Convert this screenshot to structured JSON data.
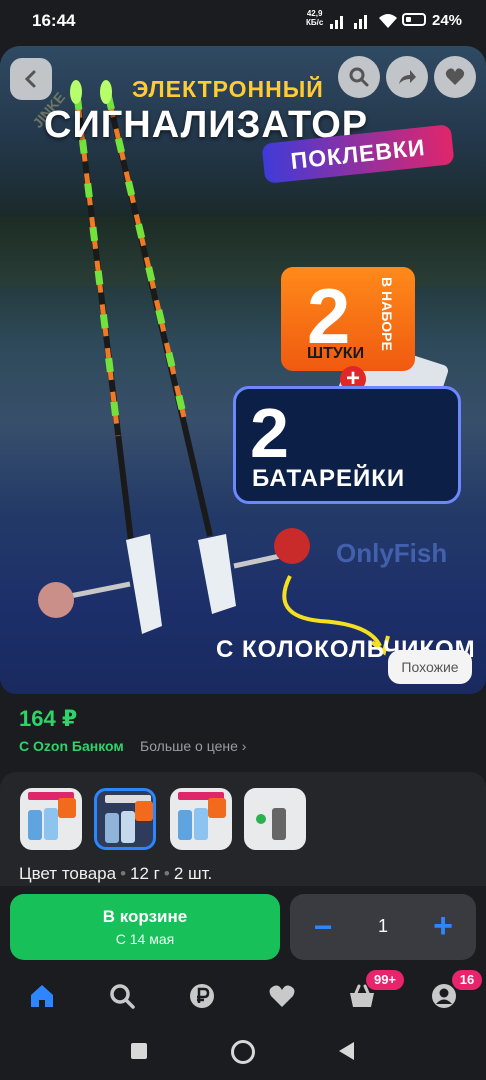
{
  "status_bar": {
    "time": "16:44",
    "net_speed_value": "42,9",
    "net_speed_unit": "КБ/с",
    "battery": "24%"
  },
  "hero": {
    "line1": "ЭЛЕКТРОННЫЙ",
    "line2": "СИГНАЛИЗАТОР",
    "line3": "ПОКЛЕВКИ",
    "kit_count": "2",
    "kit_word": "ШТУКИ",
    "kit_side": "В НАБОРЕ",
    "batt_count": "2",
    "batt_word": "БАТАРЕЙКИ",
    "bell_text": "С КОЛОКОЛЬЧИКОМ",
    "watermark": "OnlyFish",
    "watermark2": "JINKE",
    "similar_label": "Похожие"
  },
  "price": {
    "value": "164 ₽",
    "bank": "С Ozon Банком",
    "more": "Больше о цене"
  },
  "variants": {
    "selected_index": 1,
    "attributes": [
      "Цвет товара",
      "12 г",
      "2 шт."
    ]
  },
  "cart": {
    "label": "В корзине",
    "date": "С 14 мая",
    "qty": "1",
    "minus": "−",
    "plus": "+"
  },
  "nav": {
    "cart_badge": "99+",
    "profile_badge": "16"
  },
  "colors": {
    "green": "#18c05a",
    "price_green": "#2fd36a",
    "blue": "#2d86ff",
    "badge": "#e8246d"
  }
}
